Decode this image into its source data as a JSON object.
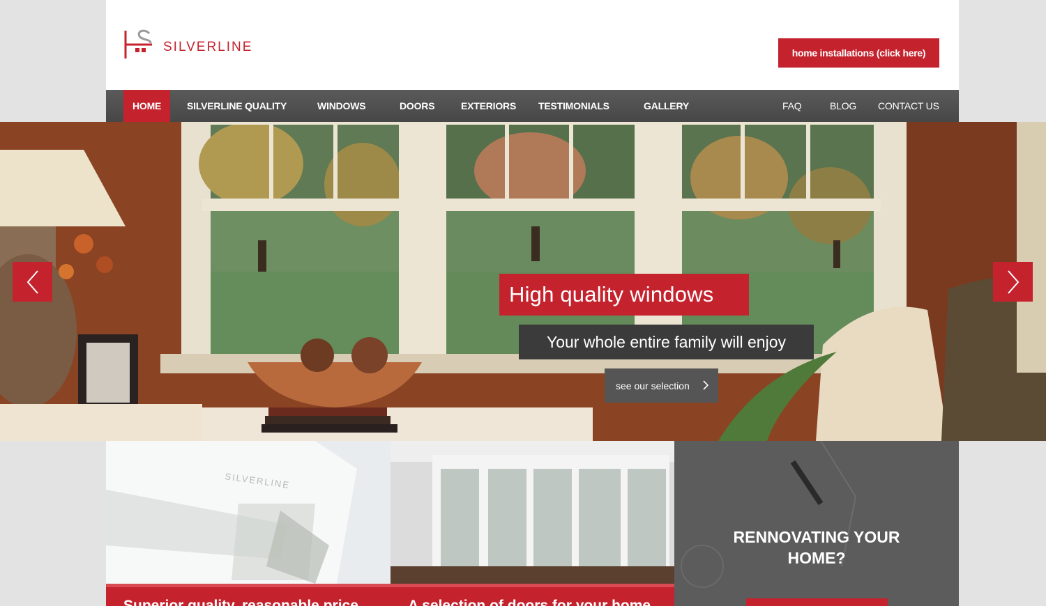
{
  "brand": {
    "name": "SILVERLINE",
    "accent": "#c4232e"
  },
  "header": {
    "cta_label": "home installations (click here)"
  },
  "nav": {
    "primary": [
      "HOME",
      "SILVERLINE QUALITY",
      "WINDOWS",
      "DOORS",
      "EXTERIORS",
      "TESTIMONIALS",
      "GALLERY"
    ],
    "secondary": [
      "FAQ",
      "BLOG",
      "CONTACT US"
    ],
    "active": "HOME"
  },
  "hero": {
    "title": "High quality windows",
    "subtitle": "Your whole entire family will enjoy",
    "button_label": "see our selection",
    "prev_icon": "chevron-left-icon",
    "next_icon": "chevron-right-icon"
  },
  "tiles": [
    {
      "label": "Superior quality, reasonable price",
      "image": "vinyl-window-profile"
    },
    {
      "label": "A selection of doors for your home",
      "image": "french-doors-interior"
    },
    {
      "title_line1": "RENNOVATING YOUR",
      "title_line2": "HOME?",
      "image": "blueprint-sketch"
    }
  ]
}
